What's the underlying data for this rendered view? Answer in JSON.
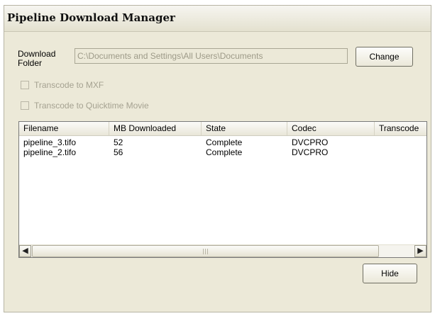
{
  "window": {
    "title": "Pipeline Download Manager"
  },
  "folder": {
    "label_line1": "Download",
    "label_line2": "Folder",
    "path": "C:\\Documents and Settings\\All Users\\Documents",
    "change_label": "Change"
  },
  "options": {
    "mxf_label": "Transcode to MXF",
    "mxf_checked": false,
    "quicktime_label": "Transcode to Quicktime Movie",
    "quicktime_checked": false
  },
  "table": {
    "columns": [
      "Filename",
      "MB Downloaded",
      "State",
      "Codec",
      "Transcode"
    ],
    "rows": [
      [
        "pipeline_3.tifo",
        "52",
        "Complete",
        "DVCPRO",
        ""
      ],
      [
        "pipeline_2.tifo",
        "56",
        "Complete",
        "DVCPRO",
        ""
      ]
    ]
  },
  "scrollbar": {
    "left_icon": "scroll-left-arrow-icon",
    "right_icon": "scroll-right-arrow-icon"
  },
  "hide_label": "Hide"
}
